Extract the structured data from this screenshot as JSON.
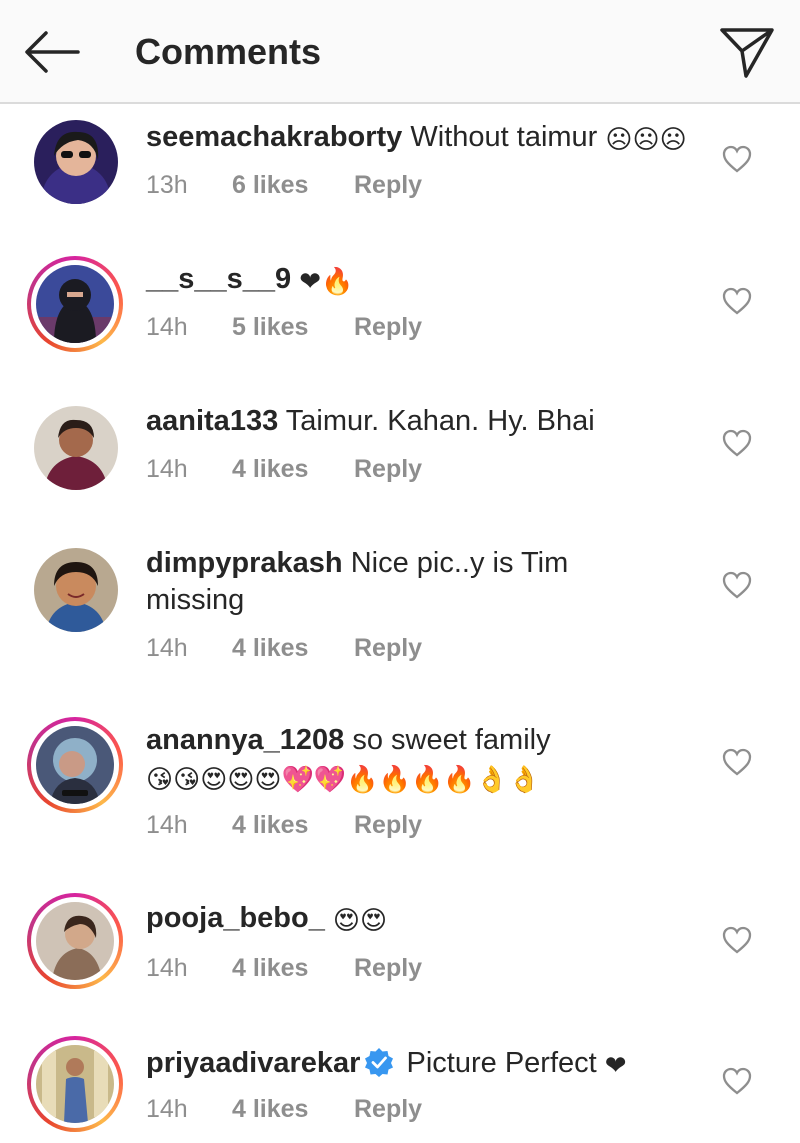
{
  "header": {
    "title": "Comments",
    "back_icon": "arrow-left-icon",
    "send_icon": "paper-plane-icon"
  },
  "comments": [
    {
      "username": "seemachakraborty",
      "text": "Without taimur",
      "emojis": "☹☹☹",
      "time": "13h",
      "likes": "6 likes",
      "reply": "Reply",
      "story_ring": false,
      "avatar_color": "#3a2a6e"
    },
    {
      "username": "__s__s__9",
      "text": "",
      "emojis": "❤🔥",
      "time": "14h",
      "likes": "5 likes",
      "reply": "Reply",
      "story_ring": true,
      "avatar_color": "#2b2f3a"
    },
    {
      "username": "aanita133",
      "text": "Taimur.  Kahan. Hy. Bhai",
      "emojis": "",
      "time": "14h",
      "likes": "4 likes",
      "reply": "Reply",
      "story_ring": false,
      "avatar_color": "#7a3848"
    },
    {
      "username": "dimpyprakash",
      "text": "Nice pic..y is Tim missing",
      "emojis": "",
      "time": "14h",
      "likes": "4 likes",
      "reply": "Reply",
      "story_ring": false,
      "avatar_color": "#8a5a3c"
    },
    {
      "username": "anannya_1208",
      "text": "so sweet family",
      "emojis": "😘😘😍😍😍💖💖🔥🔥🔥🔥👌👌",
      "time": "14h",
      "likes": "4 likes",
      "reply": "Reply",
      "story_ring": true,
      "avatar_color": "#5a6a8a"
    },
    {
      "username": "pooja_bebo_",
      "text": "",
      "emojis": "😍😍",
      "time": "14h",
      "likes": "4 likes",
      "reply": "Reply",
      "story_ring": true,
      "avatar_color": "#b9a99a"
    },
    {
      "username": "priyaadivarekar",
      "verified": true,
      "text": "Picture Perfect",
      "emojis": "❤",
      "time": "14h",
      "likes": "4 likes",
      "reply": "Reply",
      "story_ring": true,
      "avatar_color": "#c7b07a"
    }
  ],
  "colors": {
    "text": "#262626",
    "meta": "#8e8e8e",
    "divider": "#dbdbdb",
    "verified": "#3897f0"
  }
}
